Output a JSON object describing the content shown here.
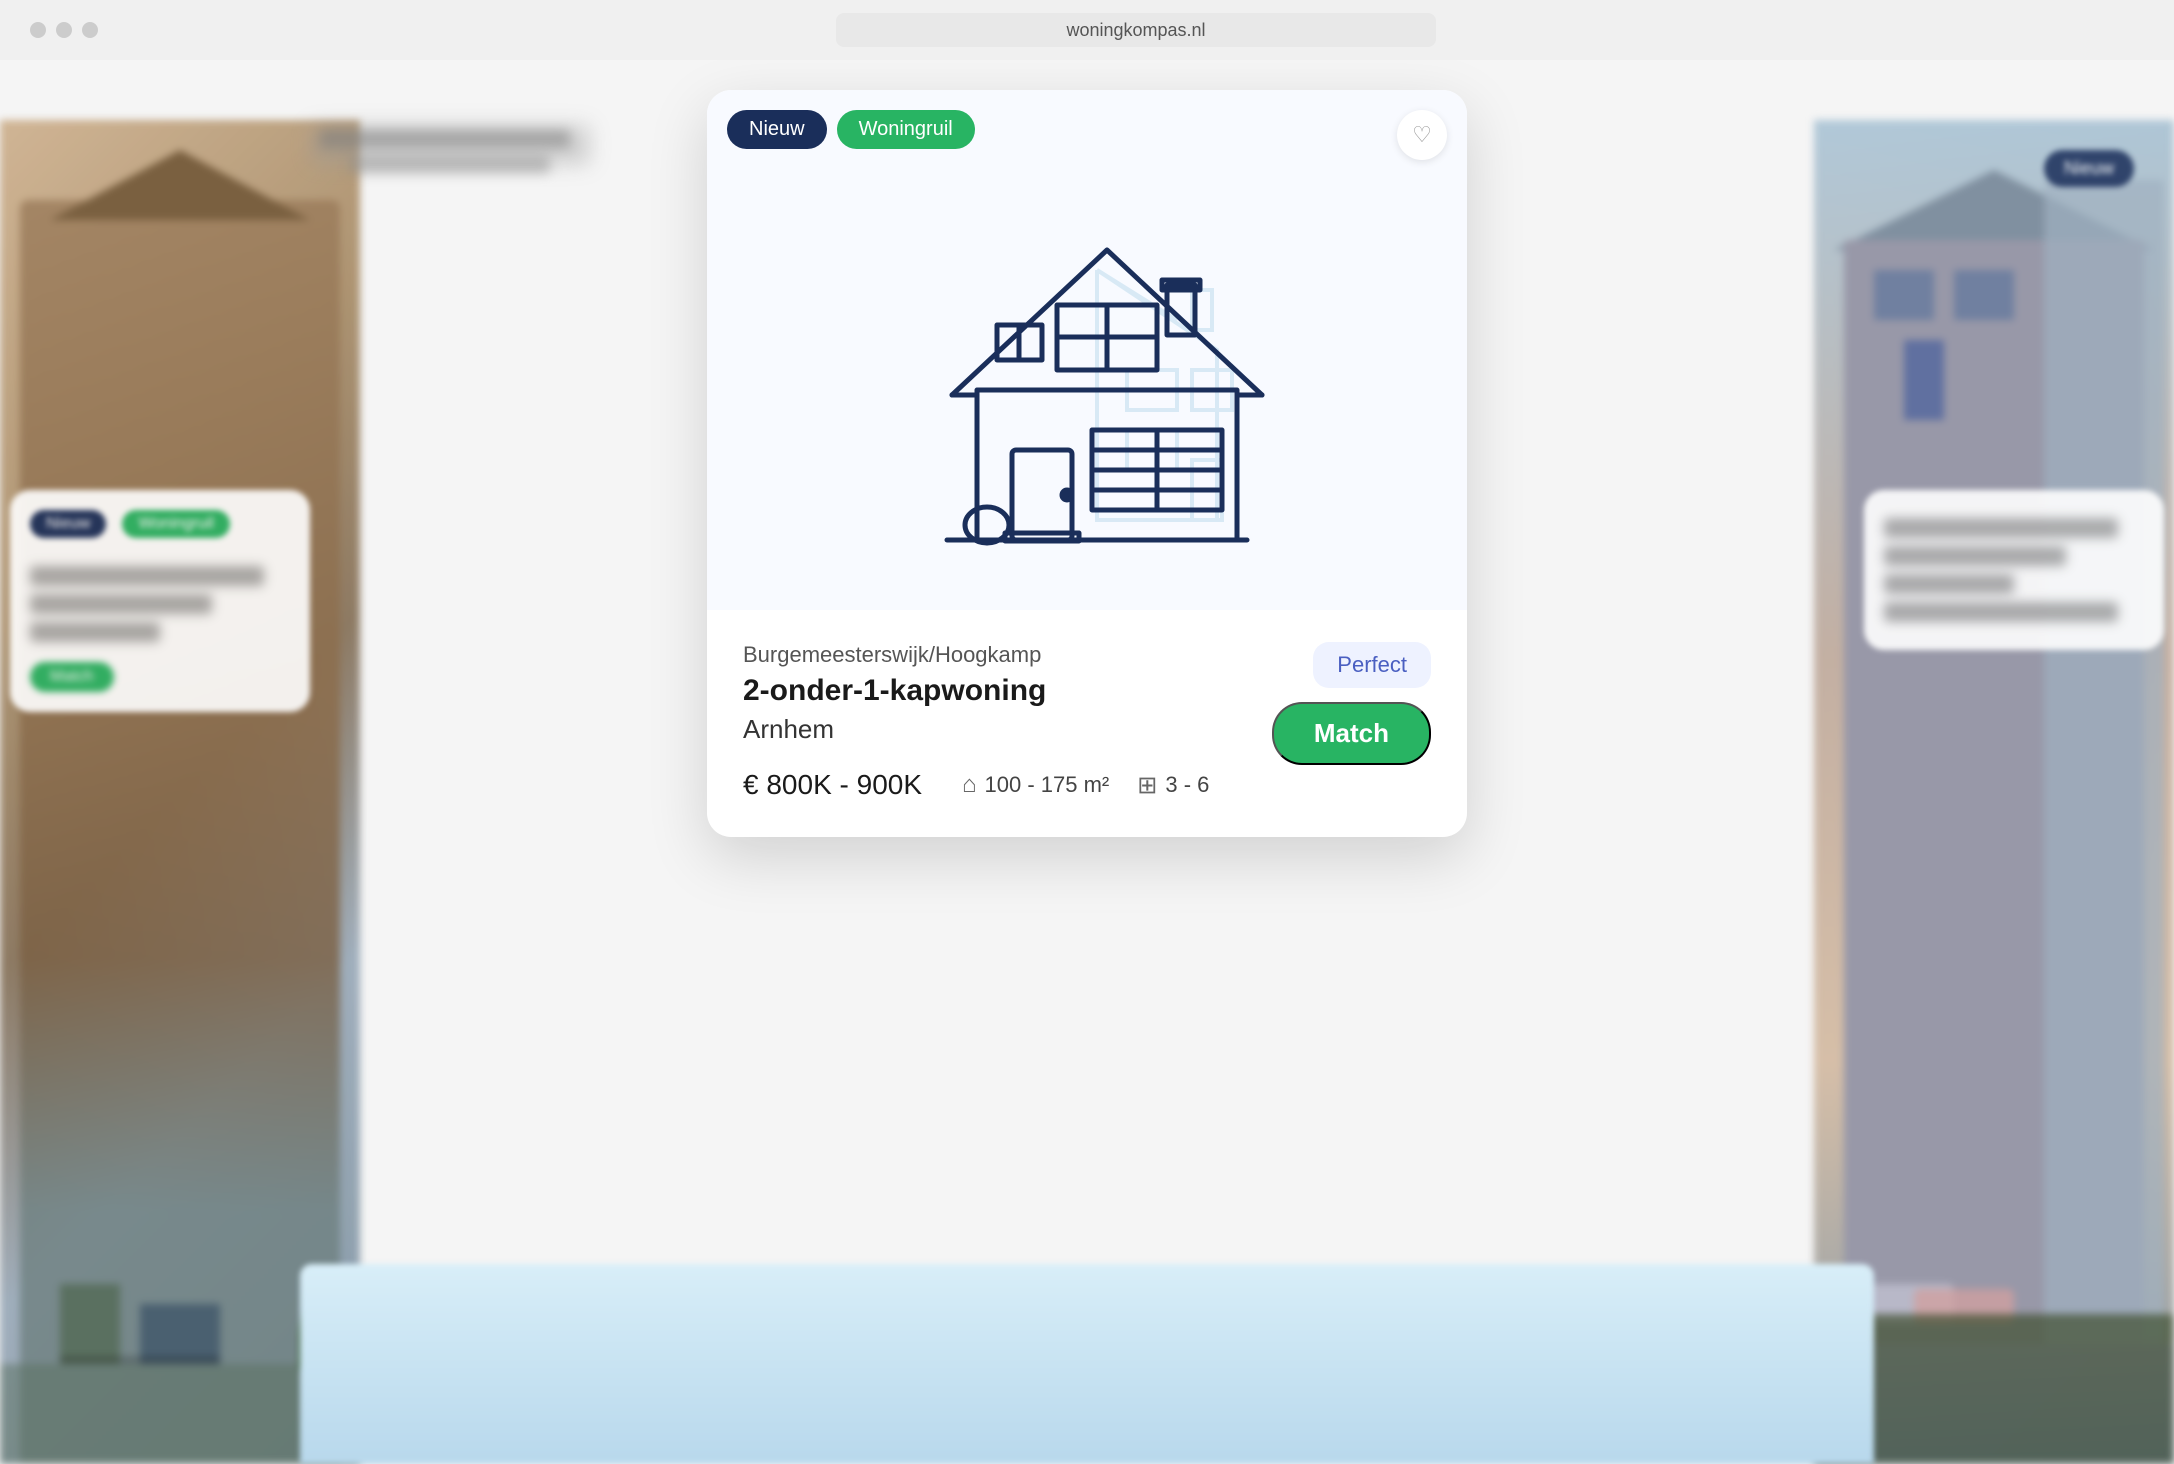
{
  "browser": {
    "url": "woningkompas.nl",
    "traffic_lights": [
      "close",
      "minimize",
      "maximize"
    ]
  },
  "card": {
    "badges": {
      "nieuw": "Nieuw",
      "woningruil": "Woningruil"
    },
    "favorite_icon": "♡",
    "neighborhood": "Burgemeesterswijk/Hoogkamp",
    "house_type": "2-onder-1-kapwoning",
    "city": "Arnhem",
    "price": "€ 800K - 900K",
    "size": "100 - 175 m²",
    "rooms": "3 - 6",
    "match_quality": "Perfect",
    "match_label": "Match"
  },
  "left_card": {
    "badge1": "Nieuw",
    "badge2": "Woningruil"
  },
  "right_card": {
    "badge": "Nieuw"
  }
}
